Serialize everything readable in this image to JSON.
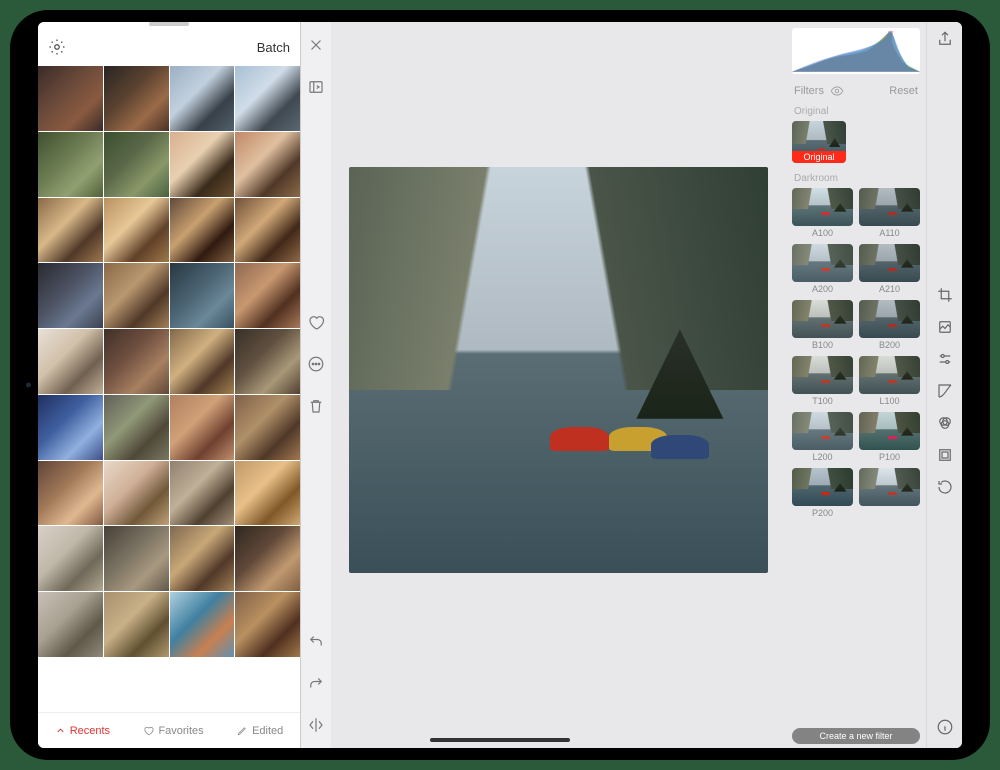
{
  "library": {
    "batch_label": "Batch",
    "tabs": {
      "recents": "Recents",
      "favorites": "Favorites",
      "edited": "Edited"
    },
    "thumbnail_count": 36
  },
  "filters_panel": {
    "header_label": "Filters",
    "reset_label": "Reset",
    "sections": {
      "original": "Original",
      "darkroom": "Darkroom"
    },
    "original_badge": "Original",
    "create_filter_label": "Create a new filter",
    "filters": [
      {
        "name": "A100",
        "hue": "h-cool"
      },
      {
        "name": "A110",
        "hue": "h-dim"
      },
      {
        "name": "A200",
        "hue": "h-fade"
      },
      {
        "name": "A210",
        "hue": "h-dim"
      },
      {
        "name": "B100",
        "hue": "h-warm"
      },
      {
        "name": "B200",
        "hue": "h-dim"
      },
      {
        "name": "T100",
        "hue": "h-warm"
      },
      {
        "name": "L100",
        "hue": "h-warm"
      },
      {
        "name": "L200",
        "hue": "h-fade"
      },
      {
        "name": "P100",
        "hue": "h-blue"
      },
      {
        "name": "P200",
        "hue": "h-deep"
      },
      {
        "name": "",
        "hue": "h-soft"
      }
    ]
  },
  "tool_rail": {
    "tools": [
      {
        "name": "share-icon"
      },
      {
        "name": "crop-icon"
      },
      {
        "name": "filters-icon"
      },
      {
        "name": "adjust-icon"
      },
      {
        "name": "curves-icon"
      },
      {
        "name": "color-icon"
      },
      {
        "name": "frame-icon"
      },
      {
        "name": "history-icon"
      },
      {
        "name": "info-icon"
      }
    ],
    "active_tool": "filters-icon"
  },
  "mid_strip": {
    "top": [
      "close-icon",
      "sidebar-collapse-icon"
    ],
    "middle": [
      "heart-icon",
      "more-icon",
      "trash-icon"
    ],
    "bottom": [
      "undo-icon",
      "redo-icon",
      "flip-icon"
    ]
  },
  "thumb_palettes": [
    [
      "#3a2a28",
      "#6a4a3a",
      "#8a5a40",
      "#3a2a28"
    ],
    [
      "#2a2422",
      "#5a4230",
      "#9a6a48",
      "#4a3226"
    ],
    [
      "#9ab0c4",
      "#c2d0de",
      "#384048",
      "#50606c"
    ],
    [
      "#a8c0d4",
      "#d0dce8",
      "#404850",
      "#586872"
    ],
    [
      "#405030",
      "#6a7a50",
      "#90a070",
      "#506038"
    ],
    [
      "#3a5030",
      "#5a6848",
      "#8a9868",
      "#486040"
    ],
    [
      "#d8b090",
      "#e8d0b0",
      "#3a2a1a",
      "#6a5030"
    ],
    [
      "#c08868",
      "#e0c0a0",
      "#503828",
      "#8a6a48"
    ],
    [
      "#8a6a48",
      "#d8b888",
      "#503828",
      "#a07850"
    ],
    [
      "#b89060",
      "#e8c898",
      "#604028",
      "#a07848"
    ],
    [
      "#604838",
      "#c8a070",
      "#301a10",
      "#806040"
    ],
    [
      "#705038",
      "#d0a878",
      "#402818",
      "#906848"
    ],
    [
      "#2a2a30",
      "#4a5060",
      "#6a7890",
      "#3a4050"
    ],
    [
      "#8a6848",
      "#b89870",
      "#503828",
      "#a08058"
    ],
    [
      "#283840",
      "#486070",
      "#6a8898",
      "#385060"
    ],
    [
      "#906850",
      "#c89870",
      "#503020",
      "#a87858"
    ],
    [
      "#e8e0d8",
      "#d0c0a8",
      "#706050",
      "#c0b098"
    ],
    [
      "#403028",
      "#705040",
      "#a88060",
      "#604838"
    ],
    [
      "#806848",
      "#d0b080",
      "#503828",
      "#a08050"
    ],
    [
      "#383028",
      "#605040",
      "#a89878",
      "#504030"
    ],
    [
      "#203060",
      "#4060a0",
      "#90b0e0",
      "#3a5088"
    ],
    [
      "#606058",
      "#909878",
      "#504838",
      "#787860"
    ],
    [
      "#b08060",
      "#d0a078",
      "#704030",
      "#c09070"
    ],
    [
      "#806048",
      "#b09068",
      "#503828",
      "#a07850"
    ],
    [
      "#604438",
      "#a07858",
      "#e0b890",
      "#805840"
    ],
    [
      "#e8d8c8",
      "#d0b098",
      "#705838",
      "#c0a078"
    ],
    [
      "#908070",
      "#c0b098",
      "#504030",
      "#a09078"
    ],
    [
      "#c09868",
      "#e8c088",
      "#805828",
      "#d0a870"
    ],
    [
      "#d8d0c8",
      "#c0b8a8",
      "#706858",
      "#b0a890"
    ],
    [
      "#484038",
      "#787060",
      "#a89880",
      "#605848"
    ],
    [
      "#806850",
      "#c8a878",
      "#503828",
      "#a08058"
    ],
    [
      "#302820",
      "#604838",
      "#c09870",
      "#806040"
    ],
    [
      "#c8c0b8",
      "#a8a090",
      "#605848",
      "#908878"
    ],
    [
      "#a89070",
      "#c8b088",
      "#605030",
      "#b09870"
    ],
    [
      "#b0d0e0",
      "#4080a0",
      "#c88050",
      "#6090b0"
    ],
    [
      "#806048",
      "#b89060",
      "#503020",
      "#a07848"
    ]
  ]
}
